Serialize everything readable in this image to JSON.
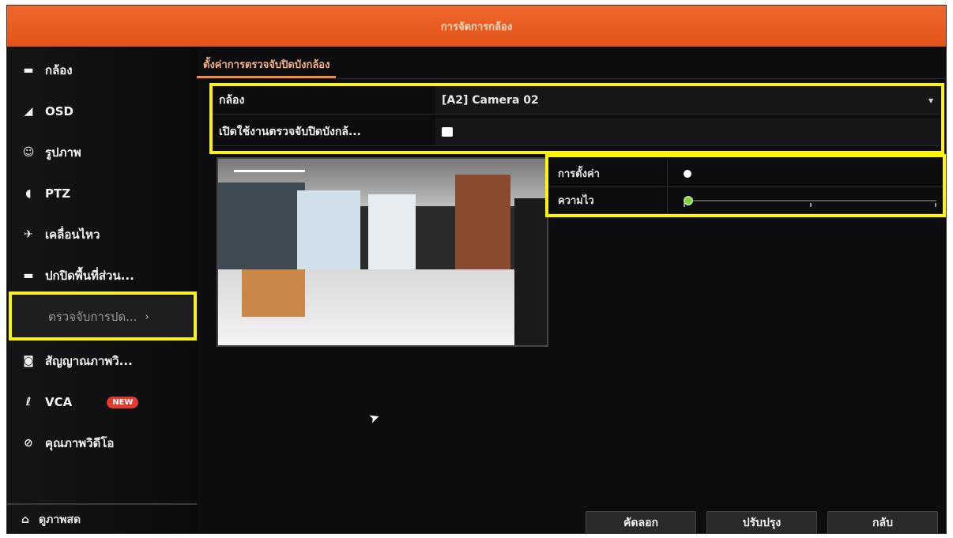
{
  "window": {
    "title": "การจัดการกล้อง"
  },
  "sidebar": {
    "items": [
      {
        "label": "กล้อง",
        "icon": "camera-icon"
      },
      {
        "label": "OSD",
        "icon": "osd-icon"
      },
      {
        "label": "รูปภาพ",
        "icon": "image-icon"
      },
      {
        "label": "PTZ",
        "icon": "ptz-icon"
      },
      {
        "label": "เคลื่อนไหว",
        "icon": "motion-icon"
      },
      {
        "label": "ปกปิดพื้นที่ส่วน...",
        "icon": "privacy-mask-icon"
      },
      {
        "label": "ตรวจจับการปด...",
        "icon": "",
        "active": true
      },
      {
        "label": "สัญญาณภาพวิ...",
        "icon": "video-loss-icon"
      },
      {
        "label": "VCA",
        "icon": "vca-icon",
        "badge": "NEW"
      },
      {
        "label": "คุณภาพวิดีโอ",
        "icon": "video-quality-icon"
      }
    ],
    "bottom": {
      "label": "ดูภาพสด",
      "icon": "home-icon"
    }
  },
  "main": {
    "tab": "ตั้งค่าการตรวจจับปิดบังกล้อง",
    "camera_label": "กล้อง",
    "camera_value": "[A2] Camera 02",
    "enable_label": "เปิดใช้งานตรวจจับปิดบังกล้...",
    "enable_checked": true,
    "settings_label": "การตั้งค่า",
    "sensitivity_label": "ความไว",
    "sensitivity_value": 0
  },
  "buttons": {
    "copy": "คัดลอก",
    "apply": "ปรับปรุง",
    "back": "กลับ"
  },
  "colors": {
    "accent": "#e2541b",
    "highlight": "#fff500",
    "slider": "#7fcf3f"
  }
}
